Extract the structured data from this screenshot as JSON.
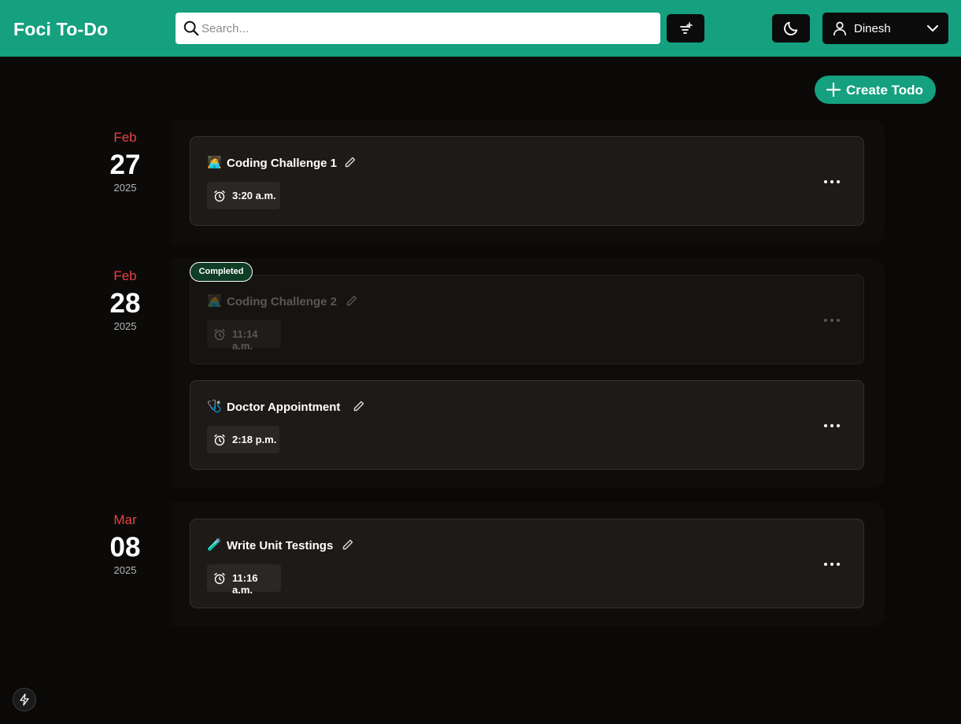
{
  "app": {
    "title": "Foci To-Do"
  },
  "header": {
    "search_placeholder": "Search...",
    "user_name": "Dinesh",
    "accent_color": "#15a07f"
  },
  "actions": {
    "create_label": "Create Todo"
  },
  "groups": [
    {
      "month": "Feb",
      "day": "27",
      "year": "2025",
      "todos": [
        {
          "emoji": "🧑‍💻",
          "title": "Coding Challenge 1",
          "time": "3:20 a.m.",
          "completed": false
        }
      ]
    },
    {
      "month": "Feb",
      "day": "28",
      "year": "2025",
      "todos": [
        {
          "emoji": "🧑‍💻",
          "title": "Coding Challenge 2",
          "time": "11:14 a.m.",
          "completed": true,
          "badge": "Completed"
        },
        {
          "emoji": "🩺",
          "title": "Doctor Appointment",
          "time": "2:18 p.m.",
          "completed": false
        }
      ]
    },
    {
      "month": "Mar",
      "day": "08",
      "year": "2025",
      "todos": [
        {
          "emoji": "🧪",
          "title": "Write Unit Testings",
          "time": "11:16 a.m.",
          "completed": false
        }
      ]
    }
  ],
  "icons": {
    "search": "search-icon",
    "filter": "filter-icon",
    "theme": "moon-icon",
    "user": "user-icon",
    "chevron": "chevron-down-icon",
    "plus": "plus-icon",
    "edit": "pencil-icon",
    "alarm": "alarm-clock-icon",
    "more": "more-horizontal-icon",
    "bolt": "lightning-icon"
  }
}
